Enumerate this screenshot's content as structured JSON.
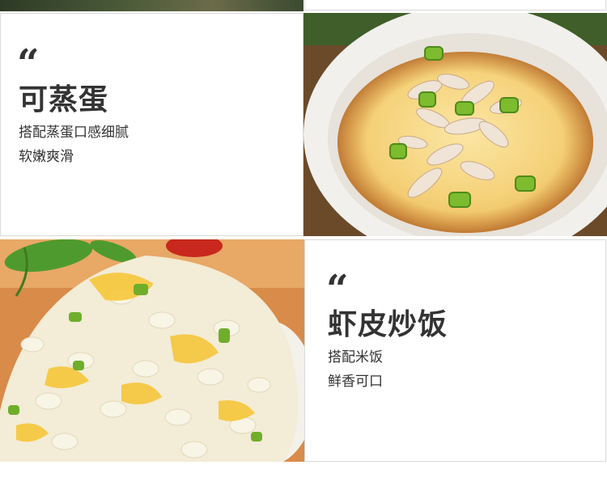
{
  "sections": [
    {
      "quote_mark": "“",
      "title": "可蒸蛋",
      "lines": [
        "搭配蒸蛋口感细腻",
        "软嫩爽滑"
      ],
      "image_icon": "steamed-egg-with-shrimp-photo"
    },
    {
      "quote_mark": "“",
      "title": "虾皮炒饭",
      "lines": [
        "搭配米饭",
        "鲜香可口"
      ],
      "image_icon": "shrimp-fried-rice-photo"
    }
  ]
}
